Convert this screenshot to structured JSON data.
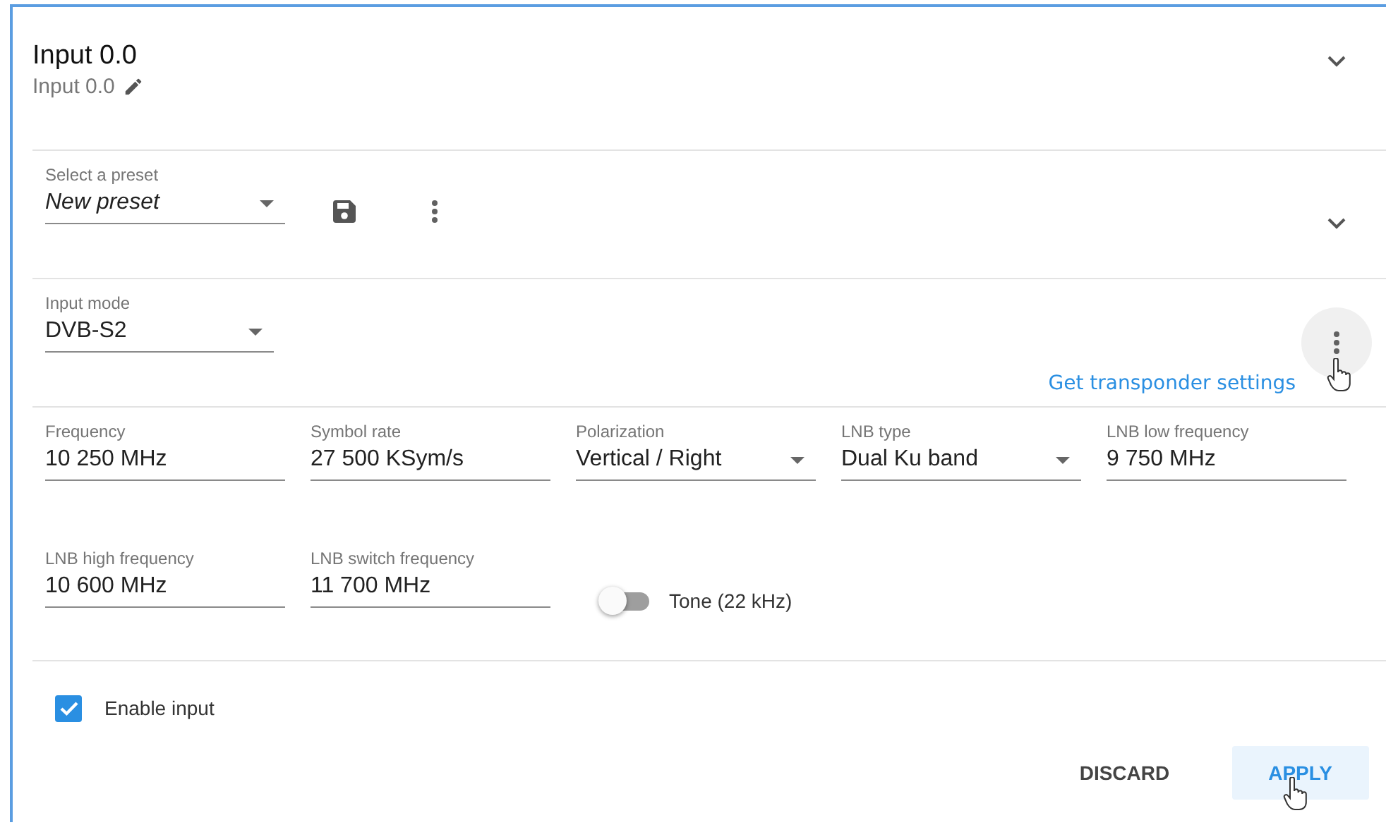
{
  "header": {
    "title": "Input 0.0",
    "subtitle": "Input 0.0"
  },
  "preset": {
    "label": "Select a preset",
    "value": "New preset"
  },
  "input_mode": {
    "label": "Input mode",
    "value": "DVB-S2"
  },
  "transponder_link": "Get transponder settings",
  "field_rows": [
    {
      "fields": [
        {
          "kind": "text",
          "label": "Frequency",
          "value": "10 250 MHz"
        },
        {
          "kind": "text",
          "label": "Symbol rate",
          "value": "27 500 KSym/s"
        },
        {
          "kind": "select",
          "label": "Polarization",
          "value": "Vertical / Right"
        },
        {
          "kind": "select",
          "label": "LNB type",
          "value": "Dual Ku band"
        },
        {
          "kind": "text",
          "label": "LNB low frequency",
          "value": "9 750 MHz"
        }
      ]
    },
    {
      "fields": [
        {
          "kind": "text",
          "label": "LNB high frequency",
          "value": "10 600 MHz"
        },
        {
          "kind": "text",
          "label": "LNB switch frequency",
          "value": "11 700 MHz"
        }
      ]
    }
  ],
  "tone": {
    "label": "Tone (22 kHz)",
    "on": false
  },
  "enable": {
    "label": "Enable input",
    "checked": true
  },
  "buttons": [
    {
      "label": "DISCARD",
      "kind": "flat"
    },
    {
      "label": "APPLY",
      "kind": "hovered"
    }
  ]
}
